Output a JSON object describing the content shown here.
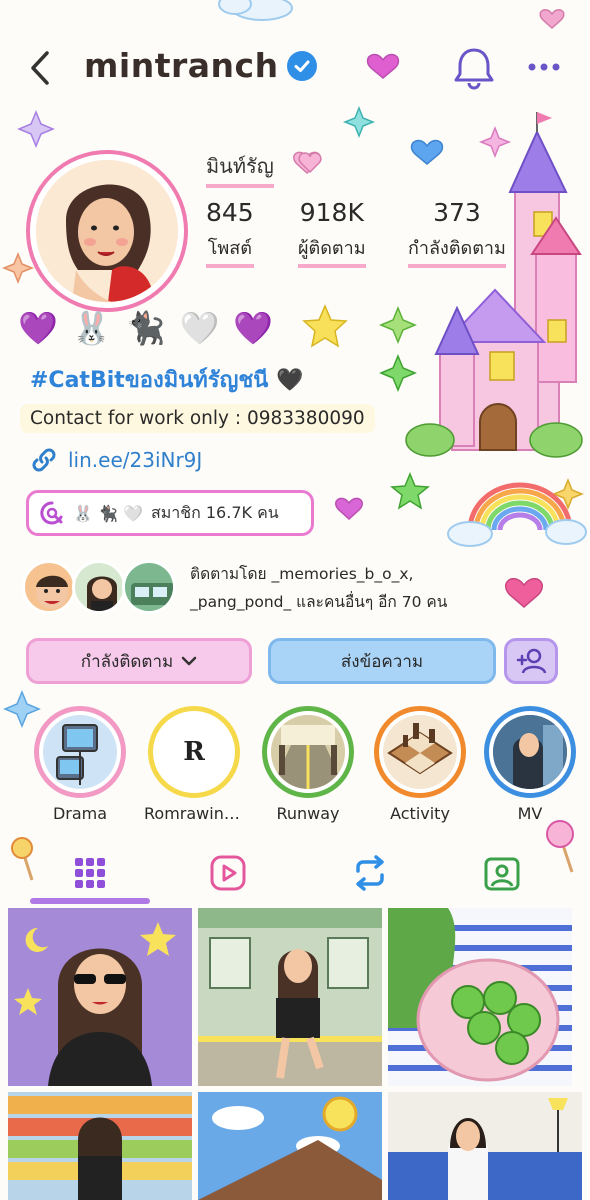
{
  "header": {
    "username": "mintranch",
    "back_icon": "back-chevron-icon",
    "verified_icon": "verified-badge-icon",
    "bell_icon": "bell-icon",
    "more_icon": "more-dots-icon"
  },
  "profile": {
    "display_name": "มินท์รัญ",
    "stats": [
      {
        "value": "845",
        "label": "โพสต์"
      },
      {
        "value": "918K",
        "label": "ผู้ติดตาม"
      },
      {
        "value": "373",
        "label": "กำลังติดตาม"
      }
    ],
    "bio_emojis": [
      "💜",
      "🐰",
      "🐈‍⬛",
      "🤍",
      "💜"
    ],
    "hashtag": "#CatBitของมินท์รัญชนี",
    "hashtag_emoji": "🖤",
    "contact": "Contact for work only : 0983380090",
    "link": "lin.ee/23iNr9J",
    "channel": {
      "emojis": "🐰 🐈‍⬛ 🤍",
      "members": "สมาชิก 16.7K คน"
    },
    "followed_by": "ติดตามโดย _memories_b_o_x, _pang_pond_ และคนอื่นๆ อีก 70 คน"
  },
  "buttons": {
    "following": "กำลังติดตาม",
    "message": "ส่งข้อความ",
    "add_user_icon": "add-user-icon"
  },
  "highlights": [
    {
      "label": "Drama",
      "ring": "#f29ac4"
    },
    {
      "label": "Romrawincli...",
      "ring": "#f5d94a",
      "letter": "R"
    },
    {
      "label": "Runway",
      "ring": "#5fb548"
    },
    {
      "label": "Activity",
      "ring": "#f08a2c"
    },
    {
      "label": "MV",
      "ring": "#3c8fe0"
    }
  ],
  "tabs": [
    {
      "name": "grid",
      "icon": "grid-icon",
      "active": true
    },
    {
      "name": "reels",
      "icon": "reels-icon",
      "active": false
    },
    {
      "name": "reposts",
      "icon": "repost-icon",
      "active": false
    },
    {
      "name": "tagged",
      "icon": "tagged-icon",
      "active": false
    }
  ],
  "colors": {
    "accent_pink": "#f07bb0",
    "accent_blue": "#2f83d8",
    "accent_purple": "#b07ae6"
  }
}
